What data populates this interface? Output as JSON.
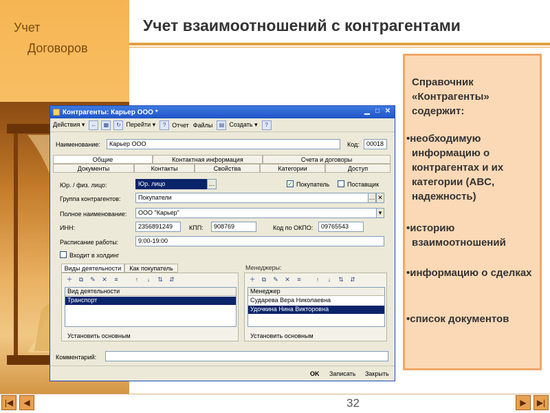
{
  "slide": {
    "section_line1": "Учет",
    "section_line2": "Договоров",
    "title": "Учет взаимоотношений с контрагентами",
    "page_number": "32"
  },
  "info": {
    "intro": "Справочник «Контрагенты» содержит:",
    "items": [
      "•необходимую информацию о контрагентах и их категории (ABC, надежность)",
      "•историю взаимоотношений",
      "•информацию о сделках",
      "•список документов"
    ]
  },
  "window": {
    "title": "Контрагенты: Карьер ООО *",
    "toolbar": {
      "actions": "Действия ▾",
      "goto": "Перейти ▾",
      "help": "?",
      "report": "Отчет",
      "files": "Файлы",
      "create": "Создать ▾"
    },
    "name_label": "Наименование:",
    "name_value": "Карьер ООО",
    "code_label": "Код:",
    "code_value": "00018",
    "tabs_row1": [
      "Общие",
      "Контактная информация",
      "Счета и договоры"
    ],
    "tabs_row2": [
      "Документы",
      "Контакты",
      "Свойства",
      "Категории",
      "Доступ"
    ],
    "legal_label": "Юр. / физ. лицо:",
    "legal_value": "Юр. лицо",
    "buyer_label": "Покупатель",
    "supplier_label": "Поставщик",
    "group_label": "Группа контрагентов:",
    "group_value": "Покупатели",
    "full_name_label": "Полное наименование:",
    "full_name_value": "ООО \"Карьер\"",
    "inn_label": "ИНН:",
    "inn_value": "2356891249",
    "kpp_label": "КПП:",
    "kpp_value": "908769",
    "okpo_label": "Код по ОКПО:",
    "okpo_value": "09765543",
    "schedule_label": "Расписание работы:",
    "schedule_value": "9:00-19:00",
    "holding_label": "Входит в холдинг",
    "activity_tabs": [
      "Виды деятельности",
      "Как покупатель"
    ],
    "activity_header": "Вид деятельности",
    "activity_rows": [
      "Транспорт"
    ],
    "set_main_left": "Установить основным",
    "managers_label": "Менеджеры:",
    "managers_header": "Менеджер",
    "managers_rows": [
      "Сударева Вера Николаевна",
      "Удочкина Нина Викторовна"
    ],
    "set_main_right": "Установить основным",
    "comment_label": "Комментарий:",
    "ok_label": "OK",
    "write_label": "Записать",
    "close_label": "Закрыть"
  },
  "colors": {
    "accent": "#e0a040",
    "info_bg": "#fbd9b6",
    "info_border": "#f0a86a",
    "window_title": "#1f55c8",
    "selection": "#0a246a"
  }
}
